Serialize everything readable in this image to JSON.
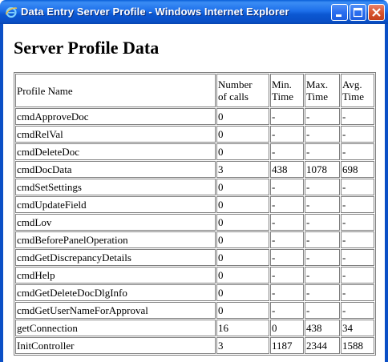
{
  "window": {
    "title": "Data Entry Server Profile - Windows Internet Explorer",
    "icon": "ie-icon",
    "buttons": [
      "minimize-icon",
      "maximize-icon",
      "close-icon"
    ],
    "colors": {
      "titlebar": "#0a5fd8",
      "close": "#d8552f"
    }
  },
  "page": {
    "heading": "Server Profile Data"
  },
  "table": {
    "headers": {
      "profile_name": "Profile Name",
      "calls_line1": "Number",
      "calls_line2": "of calls",
      "min_line1": "Min.",
      "min_line2": "Time",
      "max_line1": "Max.",
      "max_line2": "Time",
      "avg_line1": "Avg.",
      "avg_line2": "Time"
    },
    "rows": [
      {
        "name": "cmdApproveDoc",
        "calls": "0",
        "min": "-",
        "max": "-",
        "avg": "-"
      },
      {
        "name": "cmdRelVal",
        "calls": "0",
        "min": "-",
        "max": "-",
        "avg": "-"
      },
      {
        "name": "cmdDeleteDoc",
        "calls": "0",
        "min": "-",
        "max": "-",
        "avg": "-"
      },
      {
        "name": "cmdDocData",
        "calls": "3",
        "min": "438",
        "max": "1078",
        "avg": "698"
      },
      {
        "name": "cmdSetSettings",
        "calls": "0",
        "min": "-",
        "max": "-",
        "avg": "-"
      },
      {
        "name": "cmdUpdateField",
        "calls": "0",
        "min": "-",
        "max": "-",
        "avg": "-"
      },
      {
        "name": "cmdLov",
        "calls": "0",
        "min": "-",
        "max": "-",
        "avg": "-"
      },
      {
        "name": "cmdBeforePanelOperation",
        "calls": "0",
        "min": "-",
        "max": "-",
        "avg": "-"
      },
      {
        "name": "cmdGetDiscrepancyDetails",
        "calls": "0",
        "min": "-",
        "max": "-",
        "avg": "-"
      },
      {
        "name": "cmdHelp",
        "calls": "0",
        "min": "-",
        "max": "-",
        "avg": "-"
      },
      {
        "name": "cmdGetDeleteDocDlgInfo",
        "calls": "0",
        "min": "-",
        "max": "-",
        "avg": "-"
      },
      {
        "name": "cmdGetUserNameForApproval",
        "calls": "0",
        "min": "-",
        "max": "-",
        "avg": "-"
      },
      {
        "name": "getConnection",
        "calls": "16",
        "min": "0",
        "max": "438",
        "avg": "34"
      },
      {
        "name": "InitController",
        "calls": "3",
        "min": "1187",
        "max": "2344",
        "avg": "1588"
      }
    ]
  }
}
